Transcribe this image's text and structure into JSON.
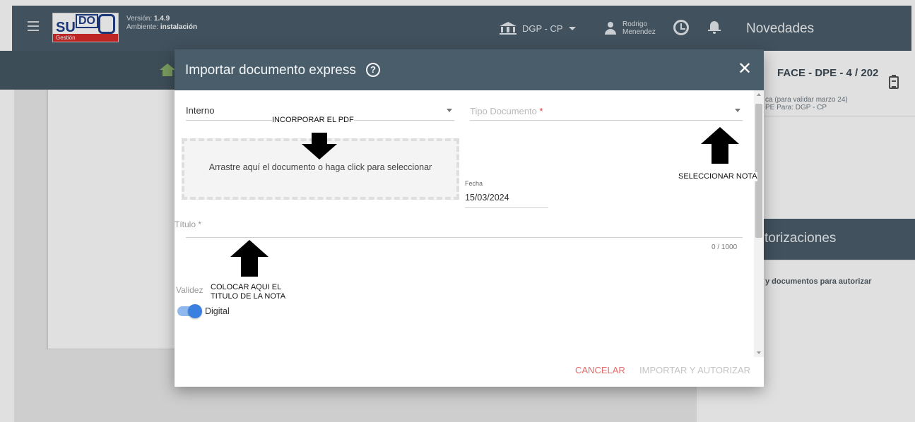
{
  "topbar": {
    "logo_main": "SU",
    "logo_do": "DO",
    "logo_sub": "Gestión",
    "version_label": "Versión: ",
    "version_value": "1.4.9",
    "ambiente_label": "Ambiente: ",
    "ambiente_value": "instalación",
    "org_selector": "DGP - CP",
    "user_first": "Rodrigo",
    "user_last": "Menendez",
    "novedades": "Novedades"
  },
  "right_panel": {
    "doc_title": "FACE - DPE - 4 / 202",
    "doc_sub1": "ca (para validar marzo 24)",
    "doc_sub2": "PE Para: DGP - CP",
    "autorizaciones": "torizaciones",
    "no_docs": "y documentos para autorizar"
  },
  "dialog": {
    "title": "Importar documento express",
    "help_glyph": "?",
    "close_glyph": "✕",
    "origin_select": "Interno",
    "tipo_placeholder": "Tipo Documento",
    "required_mark": "*",
    "dropzone_text": "Arrastre aquí el documento o haga click para seleccionar",
    "fecha_label": "Fecha",
    "fecha_value": "15/03/2024",
    "titulo_label": "Título *",
    "titulo_counter": "0 / 1000",
    "validez_label": "Validez",
    "validez_toggle_label": "Digital",
    "validez_on": true,
    "cancel_label": "CANCELAR",
    "import_label": "IMPORTAR Y AUTORIZAR"
  },
  "annotations": {
    "pdf": "INCORPORAR EL PDF",
    "nota": "SELECCIONAR NOTA",
    "titulo_line1": "COLOCAR AQUI EL",
    "titulo_line2": "TITULO DE LA NOTA"
  },
  "colors": {
    "header": "#4a5d6a",
    "accent_blue": "#3b80e0",
    "cancel_red": "#e46b6b",
    "required_red": "#d93a3a",
    "home_green": "#8ab26a"
  }
}
